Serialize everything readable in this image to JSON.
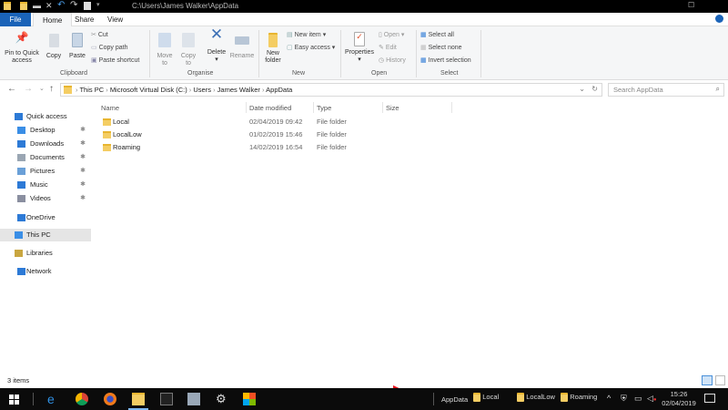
{
  "titlebar": {
    "path": "C:\\Users\\James Walker\\AppData"
  },
  "tabs": [
    {
      "label": "File"
    },
    {
      "label": "Home"
    },
    {
      "label": "Share"
    },
    {
      "label": "View"
    }
  ],
  "ribbon": {
    "clipboard": {
      "pin": "Pin to Quick",
      "pin2": "access",
      "copy": "Copy",
      "paste": "Paste",
      "cut": "Cut",
      "copy_path": "Copy path",
      "paste_shortcut": "Paste shortcut",
      "label": "Clipboard"
    },
    "organise": {
      "move": "Move",
      "move2": "to",
      "copy": "Copy",
      "copy2": "to",
      "delete": "Delete",
      "rename": "Rename",
      "label": "Organise"
    },
    "new": {
      "folder": "New",
      "folder2": "folder",
      "new_item": "New item",
      "easy_access": "Easy access",
      "label": "New"
    },
    "open": {
      "properties": "Properties",
      "open": "Open",
      "edit": "Edit",
      "history": "History",
      "label": "Open"
    },
    "select": {
      "all": "Select all",
      "none": "Select none",
      "invert": "Invert selection",
      "label": "Select"
    }
  },
  "address": {
    "crumbs": [
      "This PC",
      "Microsoft Virtual Disk (C:)",
      "Users",
      "James Walker",
      "AppData"
    ],
    "search_placeholder": "Search AppData"
  },
  "nav": [
    {
      "label": "Quick access",
      "color": "#2d7ad6"
    },
    {
      "label": "Desktop",
      "color": "#3a8ee6",
      "pin": true
    },
    {
      "label": "Downloads",
      "color": "#2d7ad6",
      "pin": true
    },
    {
      "label": "Documents",
      "color": "#9aa6b3",
      "pin": true
    },
    {
      "label": "Pictures",
      "color": "#6aa0d8",
      "pin": true
    },
    {
      "label": "Music",
      "color": "#2d7ad6",
      "pin": true
    },
    {
      "label": "Videos",
      "color": "#8a8fa0",
      "pin": true
    },
    {
      "label": "OneDrive",
      "color": "#2d7ad6"
    },
    {
      "label": "This PC",
      "color": "#3a8ee6"
    },
    {
      "label": "Libraries",
      "color": "#c9a640"
    },
    {
      "label": "Network",
      "color": "#2d7ad6"
    }
  ],
  "columns": {
    "name": "Name",
    "date": "Date modified",
    "type": "Type",
    "size": "Size"
  },
  "files": [
    {
      "name": "Local",
      "date": "02/04/2019 09:42",
      "type": "File folder"
    },
    {
      "name": "LocalLow",
      "date": "01/02/2019 15:46",
      "type": "File folder"
    },
    {
      "name": "Roaming",
      "date": "14/02/2019 16:54",
      "type": "File folder"
    }
  ],
  "status": {
    "count": "3 items"
  },
  "taskbar": {
    "toolbar_label": "AppData",
    "items": [
      "Local",
      "LocalLow",
      "Roaming"
    ],
    "time": "15:26",
    "date": "02/04/2019"
  }
}
